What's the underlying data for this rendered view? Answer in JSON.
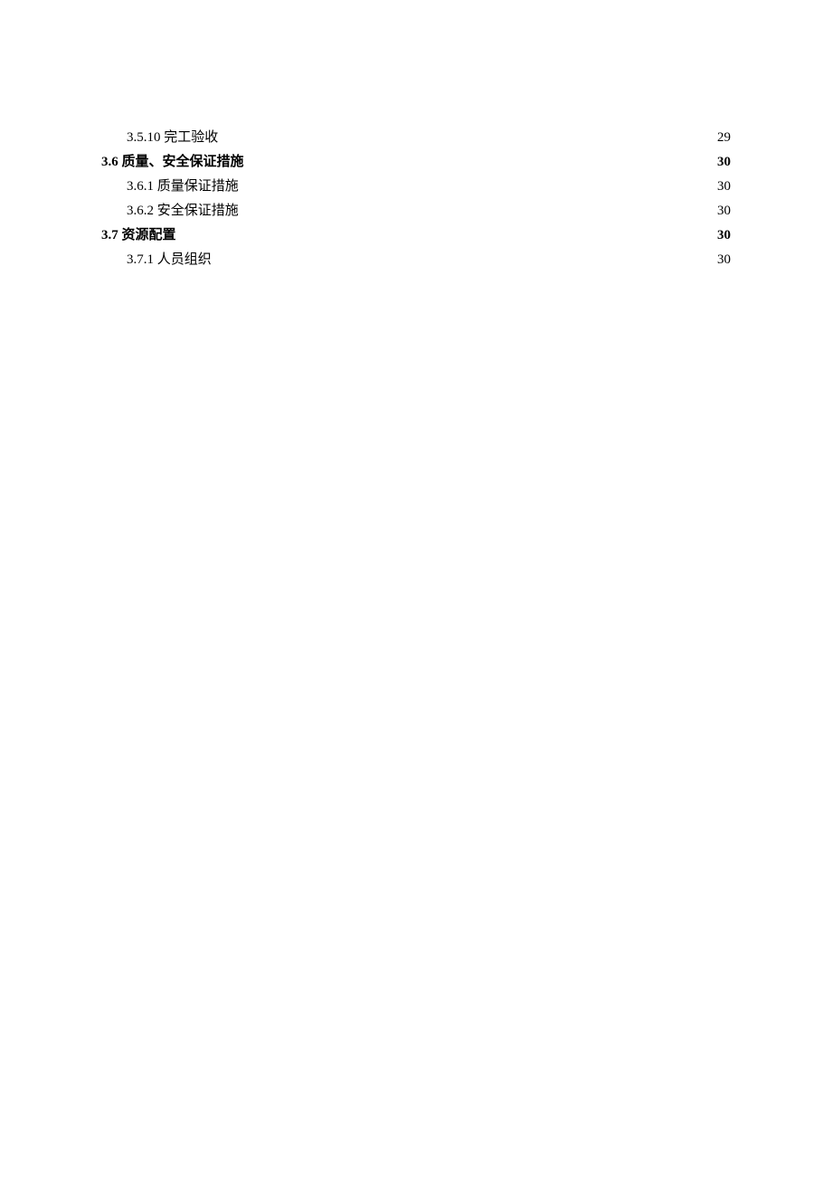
{
  "toc": {
    "entries": [
      {
        "level": 3,
        "label": "3.5.10 完工验收",
        "page": "29"
      },
      {
        "level": 1,
        "label": "3.6 质量、安全保证措施",
        "page": "30"
      },
      {
        "level": 2,
        "label": "3.6.1 质量保证措施",
        "page": "30"
      },
      {
        "level": 2,
        "label": "3.6.2 安全保证措施",
        "page": "30"
      },
      {
        "level": 1,
        "label": "3.7 资源配置",
        "page": "30"
      },
      {
        "level": 2,
        "label": "3.7.1 人员组织",
        "page": "30"
      }
    ]
  }
}
